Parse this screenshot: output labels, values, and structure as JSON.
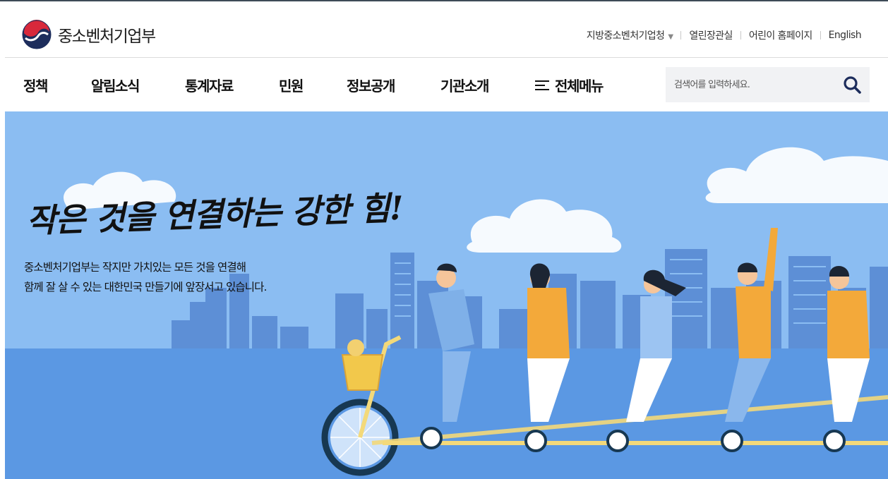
{
  "header": {
    "logo_text": "중소벤처기업부",
    "utility_links": [
      {
        "label": "지방중소벤처기업청",
        "has_dropdown": true
      },
      {
        "label": "열린장관실"
      },
      {
        "label": "어린이 홈페이지"
      },
      {
        "label": "English"
      }
    ]
  },
  "gnb": {
    "items": [
      "정책",
      "알림소식",
      "통계자료",
      "민원",
      "정보공개",
      "기관소개"
    ],
    "all_menu_label": "전체메뉴"
  },
  "search": {
    "placeholder": "검색어를 입력하세요.",
    "icon": "search-icon"
  },
  "hero": {
    "slogan": "작은 것을 연결하는 강한 힘!",
    "description_lines": [
      "중소벤처기업부는 작지만 가치있는 모든 것을 연결해",
      "함께 잘 살 수 있는 대한민국 만들기에 앞장서고 있습니다."
    ]
  },
  "colors": {
    "sky": "#8bbdf2",
    "ground": "#5b98e3",
    "accent_orange": "#f3a93a",
    "logo_red": "#d8283b",
    "logo_navy": "#1d2d5c"
  }
}
